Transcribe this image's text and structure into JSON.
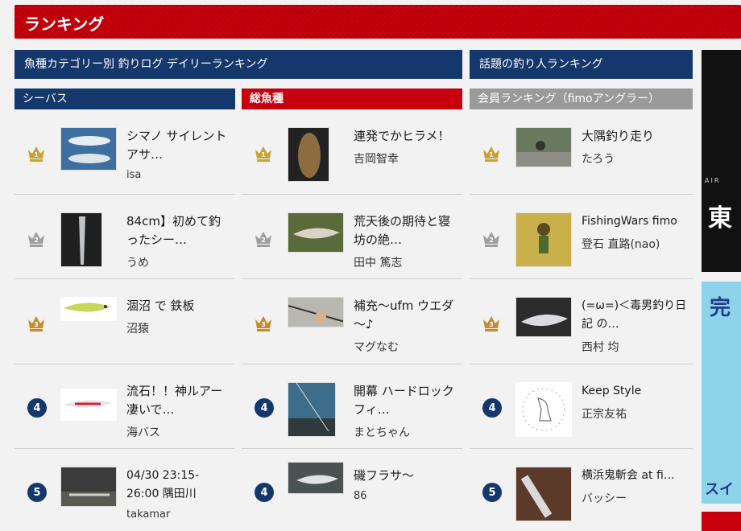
{
  "header": {
    "title": "ランキング"
  },
  "sections": {
    "left_title": "魚種カテゴリー別 釣りログ デイリーランキング",
    "right_title": "話題の釣り人ランキング"
  },
  "columns": [
    {
      "name": "シーバス",
      "items": [
        {
          "rank": "1",
          "title": "シマノ サイレントアサ…",
          "author": "isa"
        },
        {
          "rank": "2",
          "title": "84cm】初めて釣ったシー…",
          "author": "うめ"
        },
        {
          "rank": "3",
          "title": "涸沼 で 鉄板",
          "author": "沼猿"
        },
        {
          "rank": "4",
          "title": "流石！！神ルアー凄いで…",
          "author": "海バス"
        },
        {
          "rank": "5",
          "title": "04/30 23:15-26:00 隅田川",
          "author": "takamar"
        }
      ]
    },
    {
      "name": "総魚種",
      "items": [
        {
          "rank": "1",
          "title": "連発でかヒラメ！",
          "author": "吉岡智幸"
        },
        {
          "rank": "2",
          "title": "荒天後の期待と寝坊の絶…",
          "author": "田中 篤志"
        },
        {
          "rank": "3",
          "title": "補充～ufm ウエダ～♪",
          "author": "マグなむ"
        },
        {
          "rank": "4",
          "title": "開幕 ハードロックフィ…",
          "author": "まとちゃん"
        },
        {
          "rank": "4",
          "title": "磯フラサ～",
          "author": "86"
        }
      ]
    },
    {
      "name": "会員ランキング（fimoアングラー）",
      "items": [
        {
          "rank": "1",
          "title": "大隅釣り走り",
          "author": "たろう"
        },
        {
          "rank": "2",
          "title": "FishingWars fimo",
          "author": "登石 直路(nao)"
        },
        {
          "rank": "3",
          "title": "(=ω=)＜毒男釣り日記 の…",
          "author": "西村 均"
        },
        {
          "rank": "4",
          "title": "Keep Style",
          "author": "正宗友祐"
        },
        {
          "rank": "5",
          "title": "横浜鬼斬会 at fi…",
          "author": "バッシー"
        }
      ]
    }
  ],
  "banners": {
    "b1_top": "AIR",
    "b1_main": "東",
    "b2_main": "完",
    "b2_sub": "スイ"
  },
  "colors": {
    "navy": "#14386b",
    "red": "#c8000d",
    "gray": "#9a9a9a",
    "gold": "#c9a12d",
    "silver": "#9e9e9e",
    "bronze": "#c98a2e"
  },
  "icons": {
    "rank_top3": "crown-icon",
    "rank_other": "rank-number-badge"
  }
}
